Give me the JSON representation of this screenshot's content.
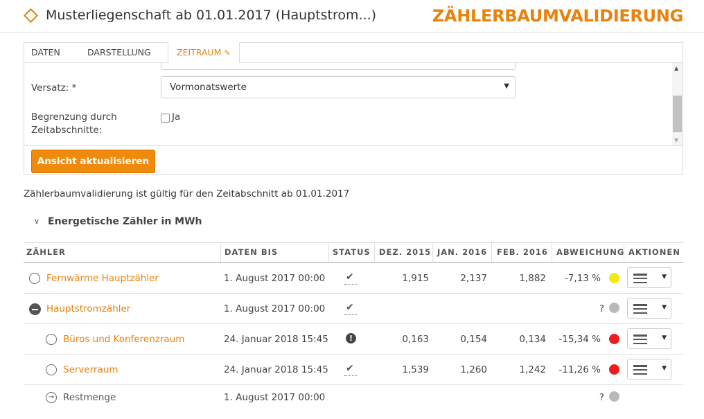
{
  "header": {
    "property_title": "Musterliegenschaft ab 01.01.2017 (Hauptstrom...)",
    "app_title": "ZÄHLERBAUMVALIDIERUNG"
  },
  "tabs": [
    {
      "label": "DATEN"
    },
    {
      "label": "DARSTELLUNG"
    },
    {
      "label": "ZEITRAUM"
    }
  ],
  "form": {
    "versatz_label": "Versatz: *",
    "versatz_value": "Vormonatswerte",
    "begrenzung_label_1": "Begrenzung durch",
    "begrenzung_label_2": "Zeitabschnitte:",
    "begrenzung_checkbox_label": "Ja"
  },
  "buttons": {
    "update": "Ansicht aktualisieren"
  },
  "validity_text": "Zählerbaumvalidierung ist gültig für den Zeitabschnitt ab 01.01.2017",
  "section_title": "Energetische Zähler in MWh",
  "table": {
    "columns": [
      "ZÄHLER",
      "DATEN BIS",
      "STATUS",
      "DEZ. 2015",
      "JAN. 2016",
      "FEB. 2016",
      "ABWEICHUNG",
      "AKTIONEN"
    ],
    "rows": [
      {
        "name": "Fernwärme Hauptzähler",
        "daten_bis": "1. August 2017 00:00",
        "dez": "1,915",
        "jan": "2,137",
        "feb": "1,882",
        "abweichung": "-7,13 %",
        "status_color": "#f2ea10"
      },
      {
        "name": "Hauptstromzähler",
        "daten_bis": "1. August 2017 00:00",
        "dez": "",
        "jan": "",
        "feb": "",
        "abweichung": "?",
        "status_color": "#b9b9b9"
      },
      {
        "name": "Büros und Konferenzraum",
        "daten_bis": "24. Januar 2018 15:45",
        "dez": "0,163",
        "jan": "0,154",
        "feb": "0,134",
        "abweichung": "-15,34 %",
        "status_color": "#ee1c1c"
      },
      {
        "name": "Serverraum",
        "daten_bis": "24. Januar 2018 15:45",
        "dez": "1,539",
        "jan": "1,260",
        "feb": "1,242",
        "abweichung": "-11,26 %",
        "status_color": "#ee1c1c"
      },
      {
        "name": "Restmenge",
        "daten_bis": "1. August 2017 00:00",
        "dez": "",
        "jan": "",
        "feb": "",
        "abweichung": "?",
        "status_color": "#b9b9b9"
      }
    ]
  },
  "icons": {
    "title_icon": "diamond-icon",
    "status_ok": "checkmark-icon",
    "status_warning": "exclamation-icon",
    "actions": "hamburger-menu-icon"
  },
  "accent_color": "#e8820c"
}
